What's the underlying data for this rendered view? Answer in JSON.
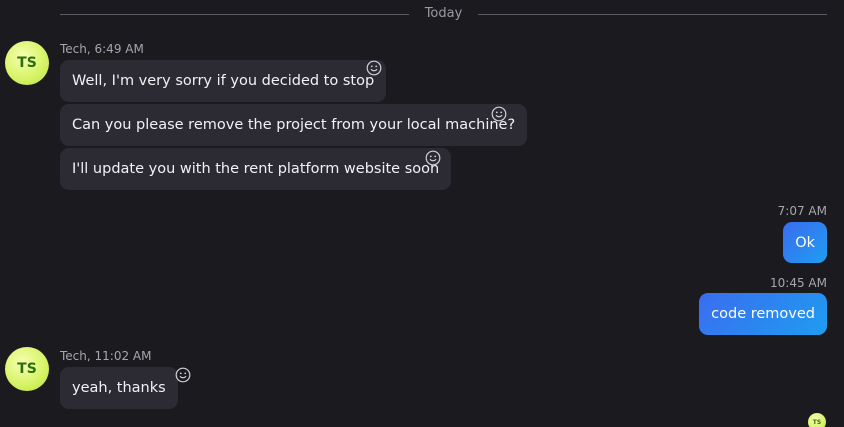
{
  "divider": {
    "label": "Today"
  },
  "messages": [
    {
      "avatar": "TS",
      "meta": "Tech, 6:49 AM",
      "bubbles": [
        "Well, I'm very sorry if you decided to stop",
        "Can you please remove the project from your local machine?",
        "I'll update you with the rent platform website soon"
      ]
    },
    {
      "meta": "7:07 AM",
      "bubbles": [
        "Ok"
      ]
    },
    {
      "meta": "10:45 AM",
      "bubbles": [
        "code removed"
      ]
    },
    {
      "avatar": "TS",
      "meta": "Tech, 11:02 AM",
      "bubbles": [
        "yeah, thanks"
      ]
    }
  ],
  "read_receipt": {
    "avatar": "TS"
  },
  "icons": {
    "reaction": "smiley-icon"
  },
  "colors": {
    "background": "#1b1a1f",
    "incoming_bubble": "#2c2b33",
    "outgoing_start": "#3a6cf0",
    "outgoing_end": "#1f9df0",
    "avatar": "#d8f46a"
  }
}
